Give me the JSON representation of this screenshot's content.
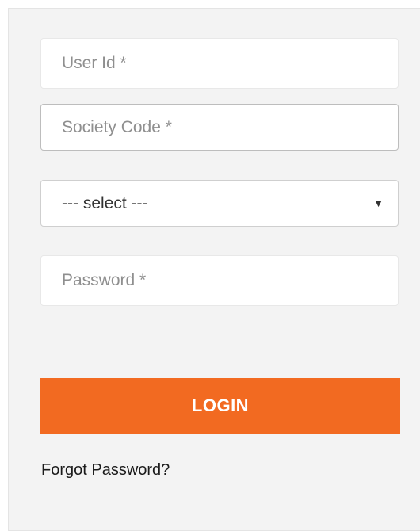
{
  "form": {
    "user_id": {
      "value": "",
      "placeholder": "User Id *"
    },
    "society_code": {
      "value": "",
      "placeholder": "Society Code *"
    },
    "select": {
      "selected": "--- select ---",
      "caret_icon": "▼"
    },
    "password": {
      "value": "",
      "placeholder": "Password *"
    },
    "login_label": "LOGIN",
    "forgot_label": "Forgot Password?"
  },
  "colors": {
    "accent": "#f26a21",
    "panel_background": "#f3f3f3"
  }
}
